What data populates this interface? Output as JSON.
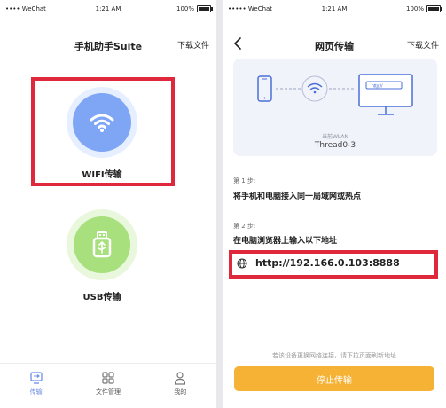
{
  "left_phone": {
    "status": {
      "carrier": "•••• WeChat",
      "time": "1:21 AM",
      "battery": "100%"
    },
    "nav": {
      "title": "手机助手Suite",
      "right_link": "下载文件"
    },
    "wifi_option": {
      "label": "WIFI传输"
    },
    "usb_option": {
      "label": "USB传输"
    },
    "tabs": [
      {
        "label": "传输",
        "icon": "transfer-icon",
        "active": true
      },
      {
        "label": "文件管理",
        "icon": "grid-icon",
        "active": false
      },
      {
        "label": "我的",
        "icon": "person-icon",
        "active": false
      }
    ],
    "accent": "#6b8fe8",
    "highlight_color": "#e0283d"
  },
  "right_phone": {
    "status": {
      "carrier": "••••• WeChat",
      "time": "1:21 AM",
      "battery": "100%"
    },
    "nav": {
      "title": "网页传输",
      "right_link": "下载文件"
    },
    "diagram": {
      "monitor_text": "http://",
      "wlan_label": "当前WLAN",
      "ssid": "Thread0-3"
    },
    "step1": {
      "label": "第 1 步:",
      "text": "将手机和电脑接入同一局域网或热点"
    },
    "step2": {
      "label": "第 2 步:",
      "text": "在电脑浏览器上输入以下地址"
    },
    "url": "http://192.166.0.103:8888",
    "bottom_note": "若该设备更换网络连接，请下拉页面刷新地址",
    "stop_button": "停止传输",
    "button_color": "#f5b234"
  }
}
